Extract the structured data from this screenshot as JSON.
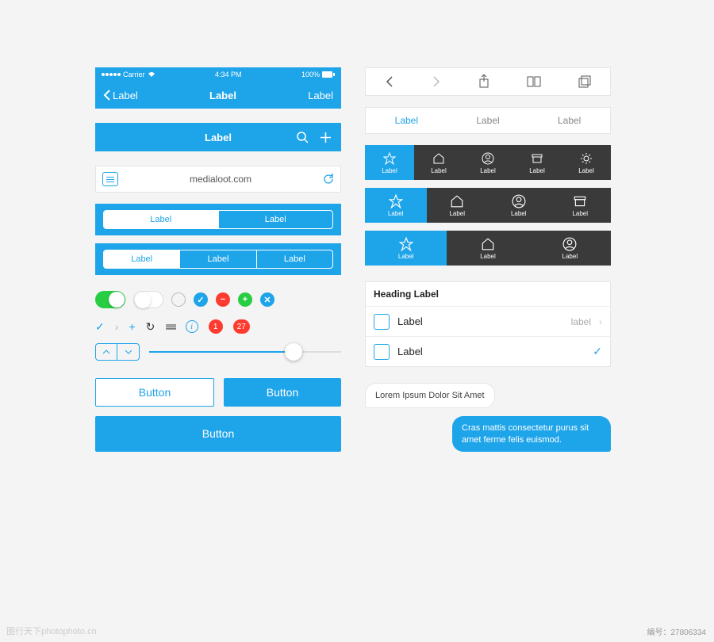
{
  "status": {
    "carrier": "Carrier",
    "time": "4:34 PM",
    "battery": "100%"
  },
  "nav": {
    "back": "Label",
    "title": "Label",
    "right": "Label"
  },
  "toolbar": {
    "title": "Label"
  },
  "url": {
    "value": "medialoot.com"
  },
  "seg2": {
    "a": "Label",
    "b": "Label"
  },
  "seg3": {
    "a": "Label",
    "b": "Label",
    "c": "Label"
  },
  "badges": {
    "one": "1",
    "many": "27"
  },
  "buttons": {
    "outline": "Button",
    "fill": "Button",
    "wide": "Button"
  },
  "whiteTabs": {
    "a": "Label",
    "b": "Label",
    "c": "Label"
  },
  "tabbar5": {
    "a": "Label",
    "b": "Label",
    "c": "Label",
    "d": "Label",
    "e": "Label"
  },
  "tabbar4": {
    "a": "Label",
    "b": "Label",
    "c": "Label",
    "d": "Label"
  },
  "tabbar3": {
    "a": "Label",
    "b": "Label",
    "c": "Label"
  },
  "list": {
    "heading": "Heading Label",
    "row1": "Label",
    "row1_detail": "label",
    "row2": "Label"
  },
  "chat": {
    "in": "Lorem Ipsum Dolor Sit Amet",
    "out": "Cras mattis consectetur purus sit amet ferme felis euismod."
  },
  "watermark": "图行天下photophoto.cn",
  "imgid": "编号：27806334"
}
